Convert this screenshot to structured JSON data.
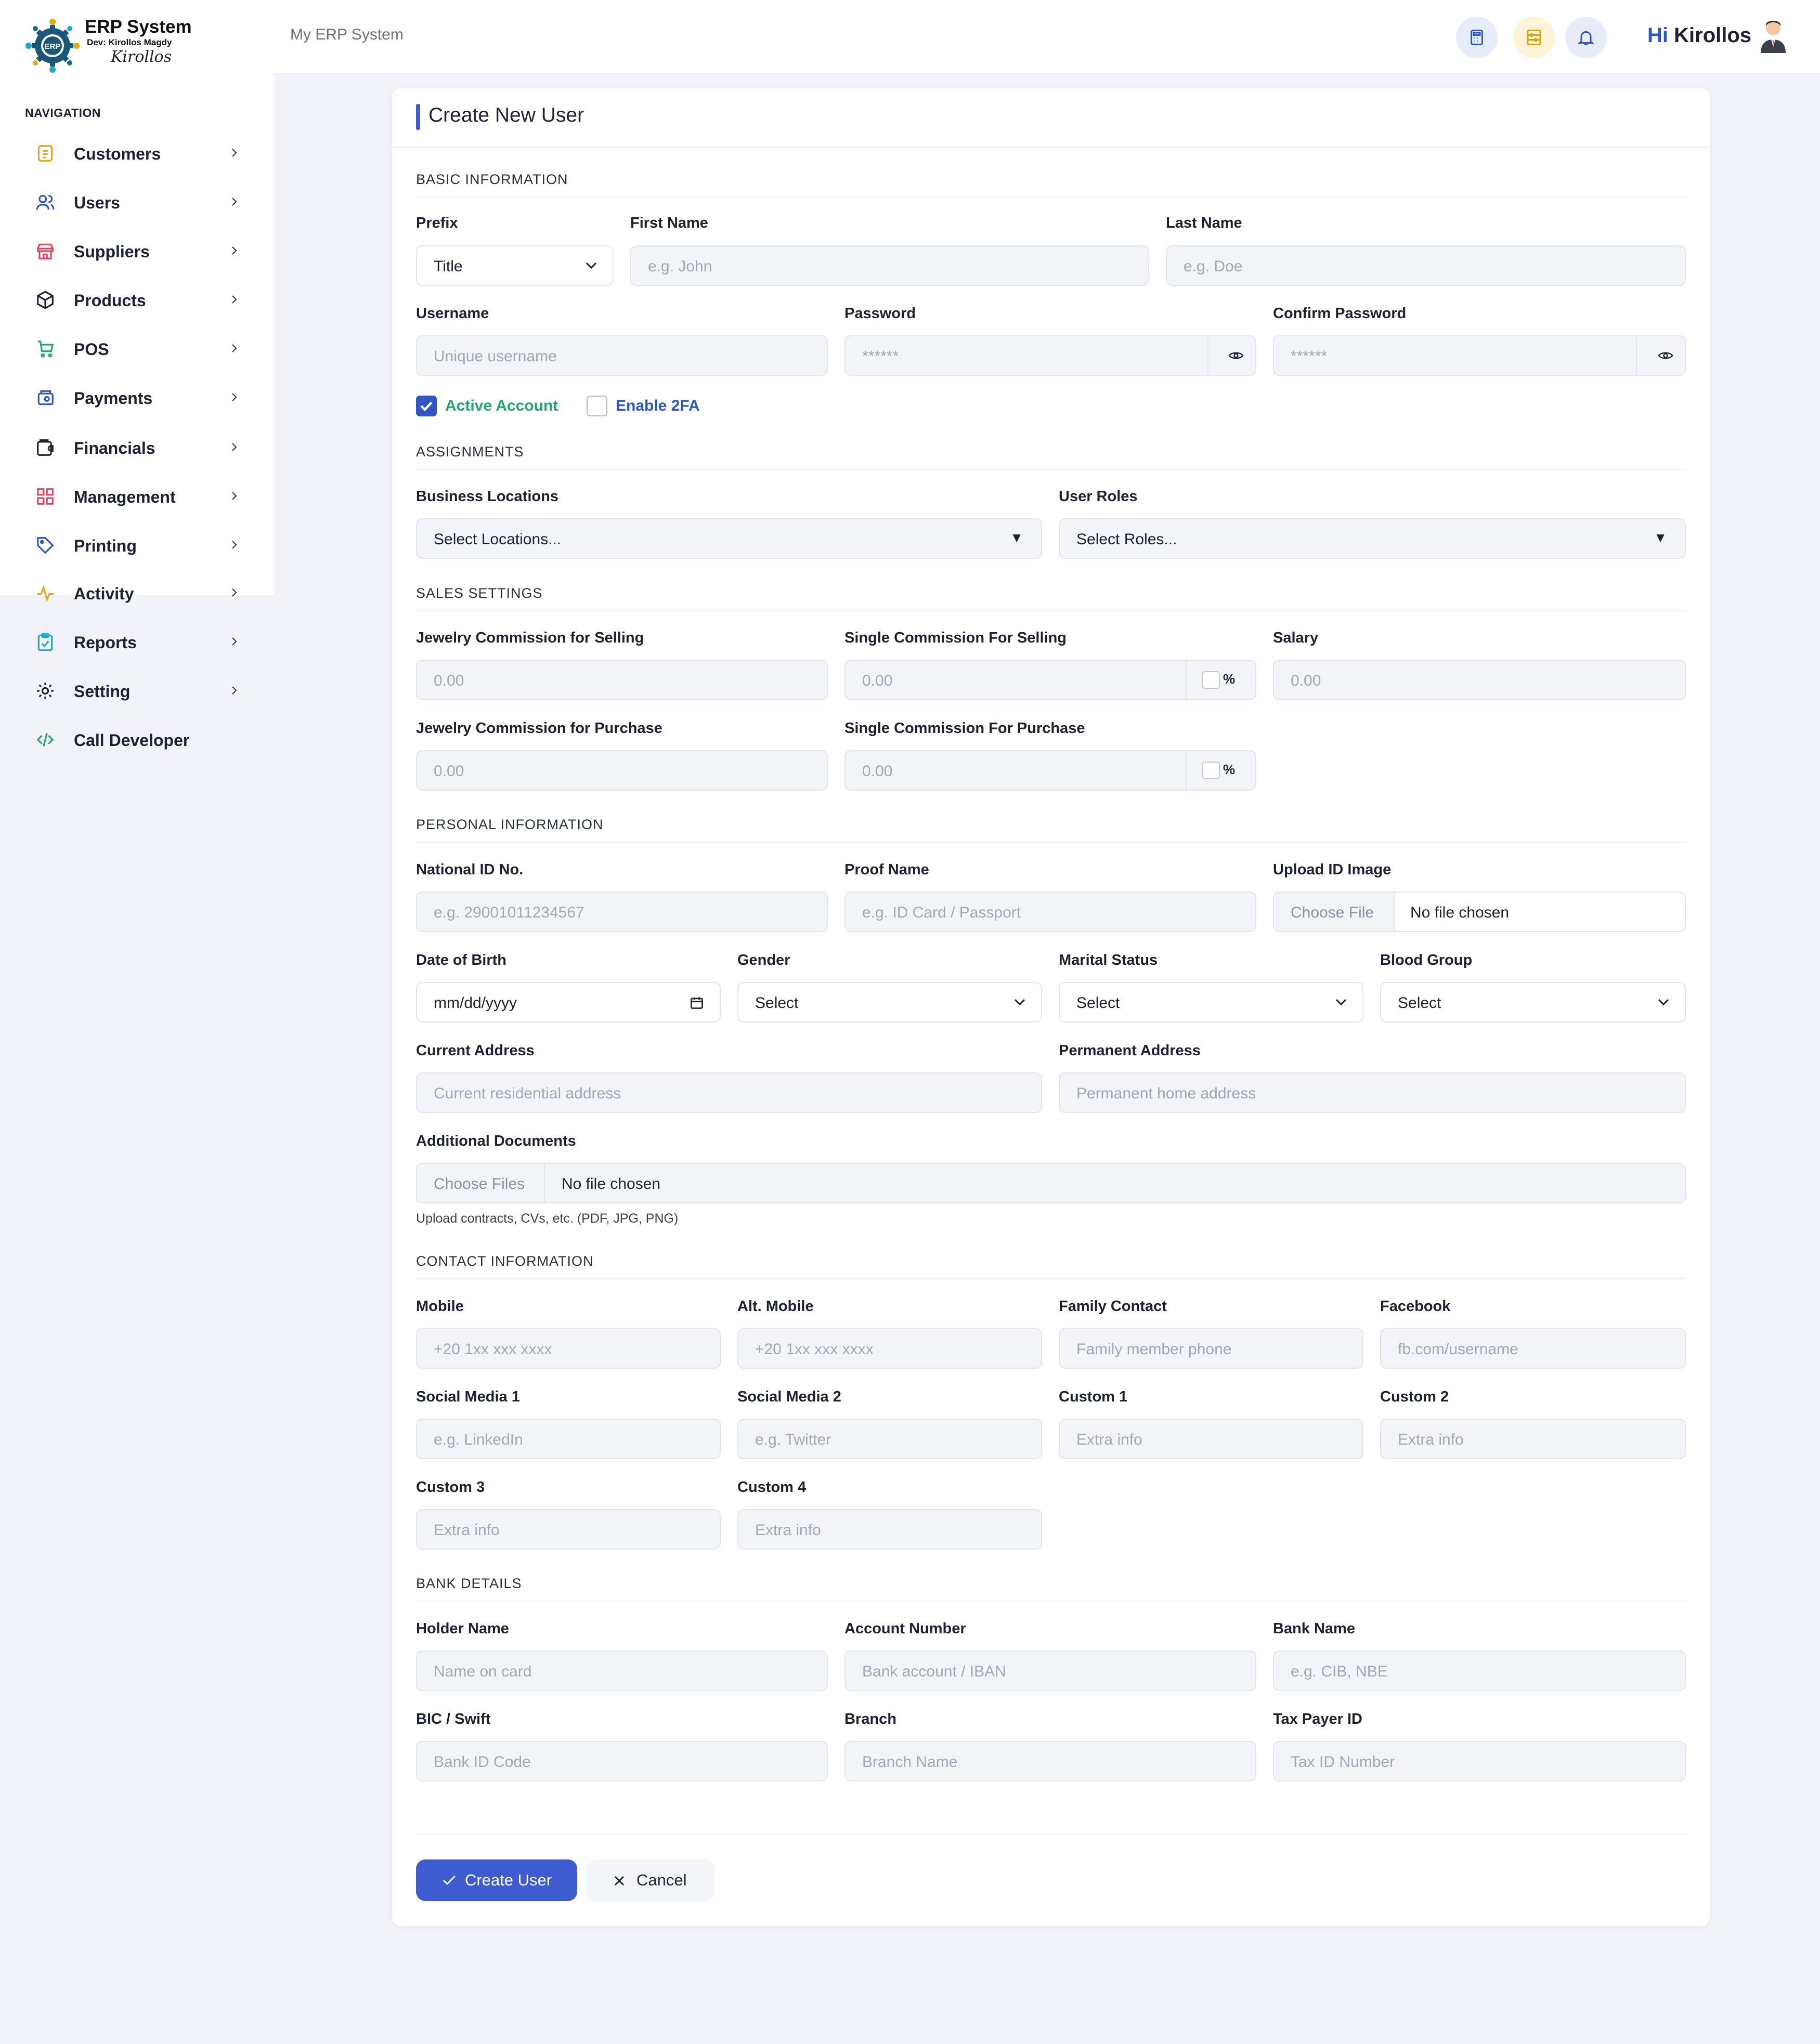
{
  "brand": {
    "name": "ERP System",
    "logo_text": "ERP",
    "dev": "Dev: Kirollos Magdy",
    "signature": "Kirollos"
  },
  "sidebar": {
    "caption": "NAVIGATION",
    "items": [
      {
        "label": "Customers",
        "icon": "customers-icon",
        "color": "#e6a817"
      },
      {
        "label": "Users",
        "icon": "users-icon",
        "color": "#2f56c5"
      },
      {
        "label": "Suppliers",
        "icon": "store-icon",
        "color": "#e0455f"
      },
      {
        "label": "Products",
        "icon": "box-icon",
        "color": "#1d2130"
      },
      {
        "label": "POS",
        "icon": "cart-icon",
        "color": "#22a86a"
      },
      {
        "label": "Payments",
        "icon": "wallet-card-icon",
        "color": "#2f56c5"
      },
      {
        "label": "Financials",
        "icon": "wallet-icon",
        "color": "#1d2130"
      },
      {
        "label": "Management",
        "icon": "grid-icon",
        "color": "#e0455f"
      },
      {
        "label": "Printing",
        "icon": "tag-icon",
        "color": "#2f56c5"
      },
      {
        "label": "Activity",
        "icon": "pulse-icon",
        "color": "#e6a817"
      },
      {
        "label": "Reports",
        "icon": "clipboard-icon",
        "color": "#1ea7c9"
      },
      {
        "label": "Setting",
        "icon": "gear-icon",
        "color": "#1d2130"
      },
      {
        "label": "Call Developer",
        "icon": "code-icon",
        "color": "#22a86a"
      }
    ]
  },
  "header": {
    "breadcrumb": "My ERP System",
    "greeting_prefix": "Hi",
    "user_name": "Kirollos",
    "buttons": [
      {
        "icon": "calculator-icon",
        "bg": "#e8ecf8",
        "color": "#2f56c5"
      },
      {
        "icon": "abacus-icon",
        "bg": "#fdf3d6",
        "color": "#d9a10f"
      },
      {
        "icon": "bell-icon",
        "bg": "#e8ecf8",
        "color": "#2f56c5"
      }
    ]
  },
  "form": {
    "title": "Create New User",
    "sections": {
      "basic": "BASIC INFORMATION",
      "assignments": "ASSIGNMENTS",
      "sales": "SALES SETTINGS",
      "personal": "PERSONAL INFORMATION",
      "contact": "CONTACT INFORMATION",
      "bank": "BANK DETAILS"
    },
    "basic": {
      "prefix_label": "Prefix",
      "prefix_value": "Title",
      "first_name_label": "First Name",
      "first_name_ph": "e.g. John",
      "last_name_label": "Last Name",
      "last_name_ph": "e.g. Doe",
      "username_label": "Username",
      "username_ph": "Unique username",
      "password_label": "Password",
      "password_ph": "******",
      "confirm_label": "Confirm Password",
      "confirm_ph": "******",
      "active_label": "Active Account",
      "active_checked": true,
      "twofa_label": "Enable 2FA",
      "twofa_checked": false
    },
    "assignments": {
      "locations_label": "Business Locations",
      "locations_value": "Select Locations...",
      "roles_label": "User Roles",
      "roles_value": "Select Roles..."
    },
    "sales": {
      "jew_sell_label": "Jewelry Commission for Selling",
      "jew_sell_ph": "0.00",
      "single_sell_label": "Single Commission For Selling",
      "single_sell_ph": "0.00",
      "salary_label": "Salary",
      "salary_ph": "0.00",
      "jew_purchase_label": "Jewelry Commission for Purchase",
      "jew_purchase_ph": "0.00",
      "single_purchase_label": "Single Commission For Purchase",
      "single_purchase_ph": "0.00",
      "percent": "%"
    },
    "personal": {
      "national_id_label": "National ID No.",
      "national_id_ph": "e.g. 29001011234567",
      "proof_label": "Proof Name",
      "proof_ph": "e.g. ID Card / Passport",
      "upload_label": "Upload ID Image",
      "upload_btn": "Choose File",
      "upload_status": "No file chosen",
      "dob_label": "Date of Birth",
      "dob_value": "mm/dd/yyyy",
      "gender_label": "Gender",
      "gender_value": "Select",
      "marital_label": "Marital Status",
      "marital_value": "Select",
      "blood_label": "Blood Group",
      "blood_value": "Select",
      "current_addr_label": "Current Address",
      "current_addr_ph": "Current residential address",
      "perm_addr_label": "Permanent Address",
      "perm_addr_ph": "Permanent home address",
      "docs_label": "Additional Documents",
      "docs_btn": "Choose Files",
      "docs_status": "No file chosen",
      "docs_help": "Upload contracts, CVs, etc. (PDF, JPG, PNG)"
    },
    "contact": {
      "mobile_label": "Mobile",
      "mobile_ph": "+20 1xx xxx xxxx",
      "alt_mobile_label": "Alt. Mobile",
      "alt_mobile_ph": "+20 1xx xxx xxxx",
      "family_label": "Family Contact",
      "family_ph": "Family member phone",
      "facebook_label": "Facebook",
      "facebook_ph": "fb.com/username",
      "social1_label": "Social Media 1",
      "social1_ph": "e.g. LinkedIn",
      "social2_label": "Social Media 2",
      "social2_ph": "e.g. Twitter",
      "custom1_label": "Custom 1",
      "custom1_ph": "Extra info",
      "custom2_label": "Custom 2",
      "custom2_ph": "Extra info",
      "custom3_label": "Custom 3",
      "custom3_ph": "Extra info",
      "custom4_label": "Custom 4",
      "custom4_ph": "Extra info"
    },
    "bank": {
      "holder_label": "Holder Name",
      "holder_ph": "Name on card",
      "account_label": "Account Number",
      "account_ph": "Bank account / IBAN",
      "bank_name_label": "Bank Name",
      "bank_name_ph": "e.g. CIB, NBE",
      "bic_label": "BIC / Swift",
      "bic_ph": "Bank ID Code",
      "branch_label": "Branch",
      "branch_ph": "Branch Name",
      "tax_label": "Tax Payer ID",
      "tax_ph": "Tax ID Number"
    },
    "actions": {
      "submit": "Create User",
      "cancel": "Cancel"
    }
  },
  "colors": {
    "accent": "#3f5bd0",
    "active_green": "#22a86a",
    "link_blue": "#2f56c5"
  }
}
